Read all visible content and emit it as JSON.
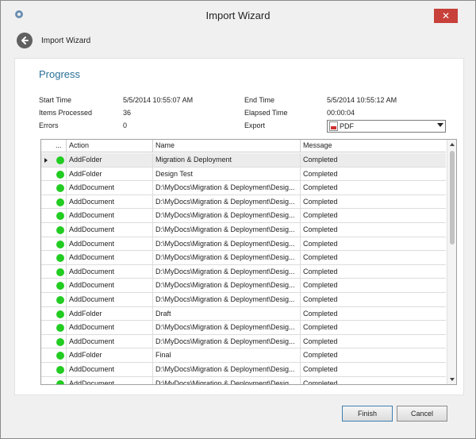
{
  "window": {
    "title": "Import Wizard",
    "close_glyph": "✕"
  },
  "nav": {
    "title": "Import Wizard"
  },
  "section": {
    "heading": "Progress"
  },
  "summary": {
    "start_time_label": "Start Time",
    "start_time_value": "5/5/2014 10:55:07 AM",
    "items_processed_label": "Items Processed",
    "items_processed_value": "36",
    "errors_label": "Errors",
    "errors_value": "0",
    "end_time_label": "End Time",
    "end_time_value": "5/5/2014 10:55:12 AM",
    "elapsed_time_label": "Elapsed Time",
    "elapsed_time_value": "00:00:04",
    "export_label": "Export",
    "export_value": "PDF"
  },
  "grid": {
    "columns": {
      "status": "...",
      "action": "Action",
      "name": "Name",
      "message": "Message"
    },
    "status_color": "#22cc22",
    "rows": [
      {
        "action": "AddFolder",
        "name": "Migration & Deployment",
        "message": "Completed"
      },
      {
        "action": "AddFolder",
        "name": "Design Test",
        "message": "Completed"
      },
      {
        "action": "AddDocument",
        "name": "D:\\MyDocs\\Migration & Deployment\\Desig...",
        "message": "Completed"
      },
      {
        "action": "AddDocument",
        "name": "D:\\MyDocs\\Migration & Deployment\\Desig...",
        "message": "Completed"
      },
      {
        "action": "AddDocument",
        "name": "D:\\MyDocs\\Migration & Deployment\\Desig...",
        "message": "Completed"
      },
      {
        "action": "AddDocument",
        "name": "D:\\MyDocs\\Migration & Deployment\\Desig...",
        "message": "Completed"
      },
      {
        "action": "AddDocument",
        "name": "D:\\MyDocs\\Migration & Deployment\\Desig...",
        "message": "Completed"
      },
      {
        "action": "AddDocument",
        "name": "D:\\MyDocs\\Migration & Deployment\\Desig...",
        "message": "Completed"
      },
      {
        "action": "AddDocument",
        "name": "D:\\MyDocs\\Migration & Deployment\\Desig...",
        "message": "Completed"
      },
      {
        "action": "AddDocument",
        "name": "D:\\MyDocs\\Migration & Deployment\\Desig...",
        "message": "Completed"
      },
      {
        "action": "AddDocument",
        "name": "D:\\MyDocs\\Migration & Deployment\\Desig...",
        "message": "Completed"
      },
      {
        "action": "AddFolder",
        "name": "Draft",
        "message": "Completed"
      },
      {
        "action": "AddDocument",
        "name": "D:\\MyDocs\\Migration & Deployment\\Desig...",
        "message": "Completed"
      },
      {
        "action": "AddDocument",
        "name": "D:\\MyDocs\\Migration & Deployment\\Desig...",
        "message": "Completed"
      },
      {
        "action": "AddFolder",
        "name": "Final",
        "message": "Completed"
      },
      {
        "action": "AddDocument",
        "name": "D:\\MyDocs\\Migration & Deployment\\Desig...",
        "message": "Completed"
      },
      {
        "action": "AddDocument",
        "name": "D:\\MyDocs\\Migration & Deployment\\Desig...",
        "message": "Completed"
      }
    ]
  },
  "buttons": {
    "finish": "Finish",
    "cancel": "Cancel"
  }
}
